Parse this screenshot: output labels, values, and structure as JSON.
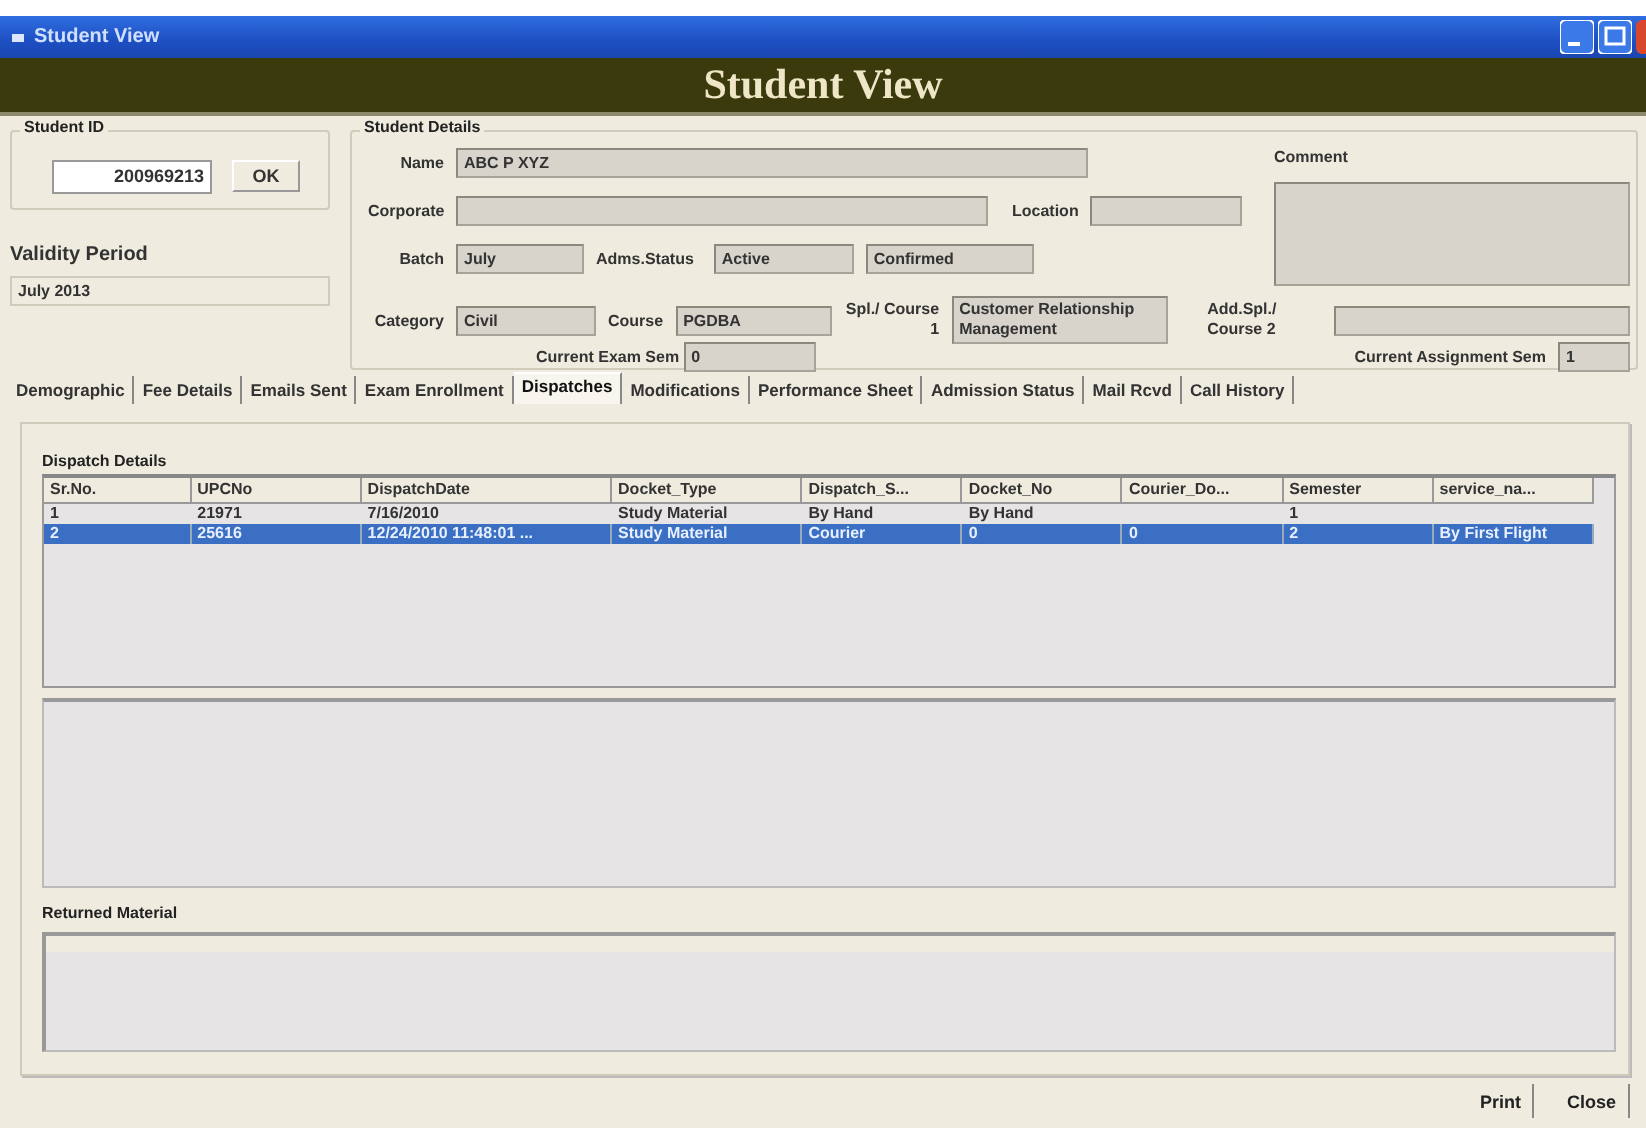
{
  "window": {
    "title": "Student View"
  },
  "header": {
    "title": "Student View"
  },
  "student_id": {
    "label": "Student ID",
    "value": "200969213",
    "ok_button": "OK"
  },
  "validity": {
    "label": "Validity Period",
    "value": "July 2013"
  },
  "student_details": {
    "title": "Student Details",
    "name": {
      "label": "Name",
      "value": "ABC P XYZ"
    },
    "comment": {
      "label": "Comment"
    },
    "corporate": {
      "label": "Corporate"
    },
    "location": {
      "label": "Location"
    },
    "batch": {
      "label": "Batch",
      "value": "July"
    },
    "adms_status": {
      "label": "Adms.Status",
      "value": "Active"
    },
    "confirmation": {
      "value": "Confirmed"
    },
    "category": {
      "label": "Category",
      "value": "Civil"
    },
    "course": {
      "label": "Course",
      "value": "PGDBA"
    },
    "spl_course_1": {
      "label": "Spl./ Course 1",
      "value": "Customer Relationship Management"
    },
    "add_spl_course_2": {
      "label": "Add.Spl./ Course 2"
    },
    "current_exam_sem": {
      "label": "Current Exam Sem",
      "value": "0"
    },
    "current_assignment_sem": {
      "label": "Current Assignment Sem",
      "value": "1"
    }
  },
  "tabs": [
    {
      "label": "Demographic",
      "selected": false
    },
    {
      "label": "Fee Details",
      "selected": false
    },
    {
      "label": "Emails Sent",
      "selected": false
    },
    {
      "label": "Exam Enrollment",
      "selected": false
    },
    {
      "label": "Dispatches",
      "selected": true
    },
    {
      "label": "Modifications",
      "selected": false
    },
    {
      "label": "Performance Sheet",
      "selected": false
    },
    {
      "label": "Admission Status",
      "selected": false
    },
    {
      "label": "Mail Rcvd",
      "selected": false
    },
    {
      "label": "Call History",
      "selected": false
    }
  ],
  "dispatches": {
    "title": "Dispatch Details",
    "columns": [
      "Sr.No.",
      "UPCNo",
      "DispatchDate",
      "Docket_Type",
      "Dispatch_S...",
      "Docket_No",
      "Courier_Do...",
      "Semester",
      "service_na..."
    ],
    "rows": [
      {
        "cells": [
          "1",
          "21971",
          "7/16/2010",
          "Study Material",
          "By Hand",
          "By Hand",
          null,
          "1",
          null
        ],
        "selected": false
      },
      {
        "cells": [
          "2",
          "25616",
          "12/24/2010 11:48:01 ...",
          "Study Material",
          "Courier",
          "0",
          "0",
          "2",
          "By First Flight"
        ],
        "selected": true
      }
    ]
  },
  "returned_material": {
    "title": "Returned Material"
  },
  "buttons": [
    "Print",
    "Close"
  ]
}
